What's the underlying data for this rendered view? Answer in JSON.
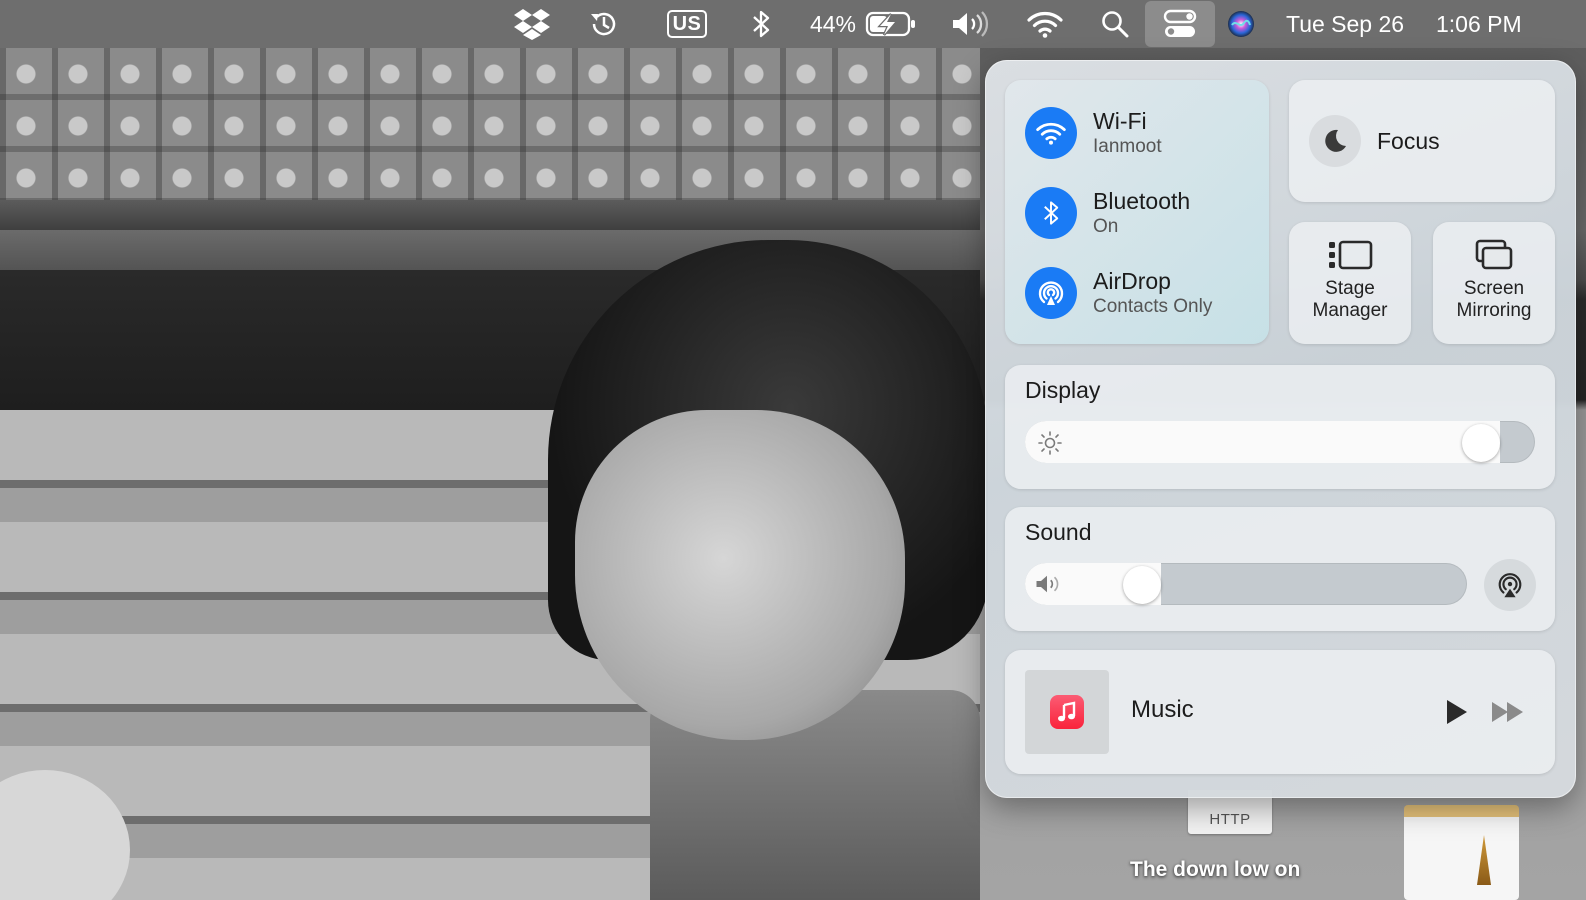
{
  "menubar": {
    "battery_percent": "44%",
    "keyboard_layout": "US",
    "date": "Tue Sep 26",
    "time": "1:06 PM",
    "icons": [
      "dropbox-icon",
      "time-machine-icon",
      "input-source-icon",
      "bluetooth-icon",
      "battery-icon",
      "volume-icon",
      "wifi-icon",
      "spotlight-icon",
      "control-center-icon",
      "siri-icon"
    ]
  },
  "control_center": {
    "wifi": {
      "title": "Wi-Fi",
      "subtitle": "Ianmoot",
      "on": true
    },
    "bluetooth": {
      "title": "Bluetooth",
      "subtitle": "On",
      "on": true
    },
    "airdrop": {
      "title": "AirDrop",
      "subtitle": "Contacts Only",
      "on": true
    },
    "focus": {
      "label": "Focus"
    },
    "stage_manager": {
      "line1": "Stage",
      "line2": "Manager"
    },
    "screen_mirroring": {
      "line1": "Screen",
      "line2": "Mirroring"
    },
    "display": {
      "title": "Display",
      "brightness": 0.93
    },
    "sound": {
      "title": "Sound",
      "volume": 0.24
    },
    "now_playing": {
      "app": "Music"
    },
    "accent_color": "#1a7bf5"
  },
  "desktop": {
    "file_label": "HTTP",
    "caption": "The down low on"
  }
}
